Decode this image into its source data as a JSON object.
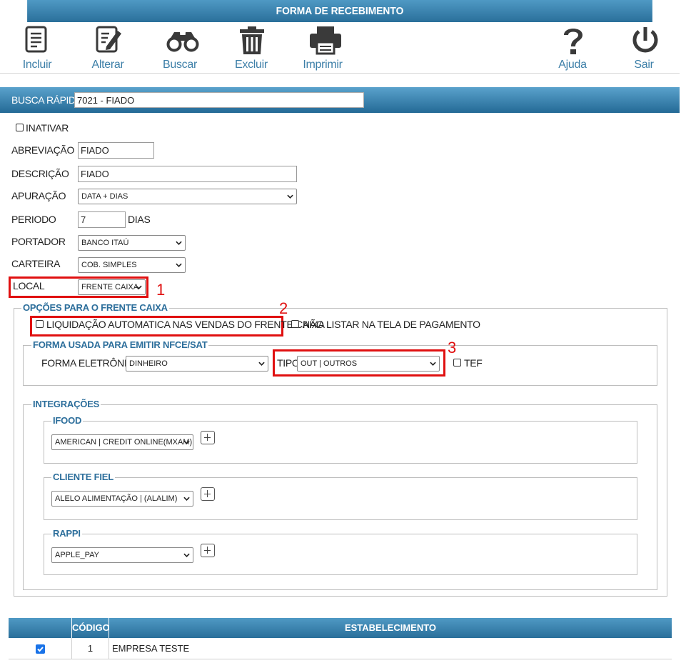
{
  "window": {
    "title": "FORMA DE RECEBIMENTO"
  },
  "toolbar": {
    "incluir": "Incluir",
    "alterar": "Alterar",
    "buscar": "Buscar",
    "excluir": "Excluir",
    "imprimir": "Imprimir",
    "ajuda": "Ajuda",
    "sair": "Sair"
  },
  "busca": {
    "label": "BUSCA RÁPIDA",
    "value": "7021 - FIADO"
  },
  "form": {
    "inativar": "INATIVAR",
    "abreviacao_label": "ABREVIAÇÃO",
    "abreviacao_value": "FIADO",
    "descricao_label": "DESCRIÇÃO",
    "descricao_value": "FIADO",
    "apuracao_label": "APURAÇÃO",
    "apuracao_value": "DATA + DIAS",
    "periodo_label": "PERIODO",
    "periodo_value": "7",
    "periodo_unit": "DIAS",
    "portador_label": "PORTADOR",
    "portador_value": "BANCO ITAÚ",
    "carteira_label": "CARTEIRA",
    "carteira_value": "COB. SIMPLES",
    "local_label": "LOCAL",
    "local_value": "FRENTE CAIXA"
  },
  "annotations": {
    "n1": "1",
    "n2": "2",
    "n3": "3"
  },
  "frente_caixa": {
    "legend": "OPÇÕES PARA O FRENTE CAIXA",
    "liquidacao": "LIQUIDAÇÃO AUTOMATICA NAS VENDAS DO FRENTE CAIXA",
    "nao_listar": "NÃO LISTAR NA TELA DE PAGAMENTO",
    "nfce": {
      "legend": "FORMA USADA PARA EMITIR NFCE/SAT",
      "forma_label": "FORMA ELETRÔNICA",
      "forma_value": "DINHEIRO",
      "tipo_label": "TIPO",
      "tipo_value": "OUT | OUTROS",
      "tef": "TEF"
    },
    "integracoes": {
      "legend": "INTEGRAÇÕES",
      "ifood": {
        "legend": "IFOOD",
        "value": "AMERICAN | CREDIT ONLINE(MXAM)"
      },
      "cliente_fiel": {
        "legend": "CLIENTE FIEL",
        "value": "ALELO ALIMENTAÇÃO | (ALALIM)"
      },
      "rappi": {
        "legend": "RAPPI",
        "value": "APPLE_PAY"
      }
    }
  },
  "table": {
    "headers": [
      "",
      "CÓDIGO",
      "ESTABELECIMENTO"
    ],
    "rows": [
      {
        "checked": true,
        "codigo": "1",
        "estabelecimento": "EMPRESA TESTE"
      }
    ]
  },
  "colors": {
    "header_blue": "#2a6f9a",
    "legend_blue": "#2c6e9b",
    "toolbar_text": "#3d7fa8",
    "highlight_red": "#e01010"
  }
}
